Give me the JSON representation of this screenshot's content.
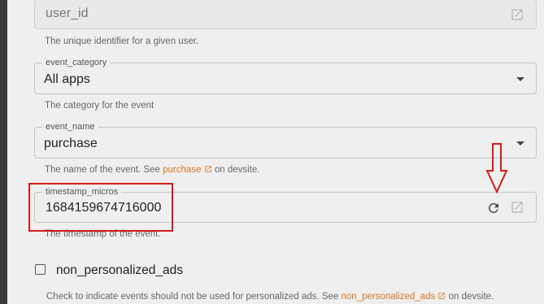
{
  "fields": {
    "user_id": {
      "placeholder": "user_id",
      "helper": "The unique identifier for a given user."
    },
    "event_category": {
      "label": "event_category",
      "value": "All apps",
      "helper": "The category for the event"
    },
    "event_name": {
      "label": "event_name",
      "value": "purchase",
      "helper_pre": "The name of the event. See ",
      "helper_link": "purchase",
      "helper_post": " on devsite."
    },
    "timestamp": {
      "label": "timestamp_micros",
      "value": "1684159674716000",
      "helper": "The timestamp of the event."
    }
  },
  "checkbox": {
    "label": "non_personalized_ads",
    "checked": false,
    "helper_pre": "Check to indicate events should not be used for personalized ads. See ",
    "helper_link": "non_personalized_ads",
    "helper_post": " on devsite."
  },
  "colors": {
    "link": "#d9741f",
    "annotation": "#d41a1a"
  },
  "icons": {
    "external": "open-in-new-icon",
    "refresh": "refresh-icon",
    "dropdown": "chevron-down-icon"
  }
}
